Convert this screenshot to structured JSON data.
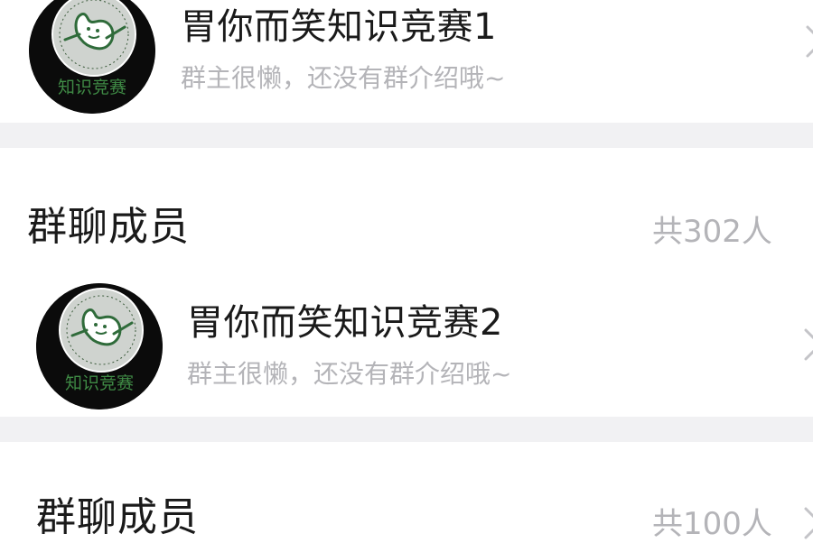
{
  "groups": [
    {
      "name": "胃你而笑知识竞赛1",
      "description": "群主很懒，还没有群介绍哦~",
      "avatar_text": "知识竞赛",
      "members_label": "群聊成员",
      "members_count": "共302人"
    },
    {
      "name": "胃你而笑知识竞赛2",
      "description": "群主很懒，还没有群介绍哦~",
      "avatar_text": "知识竞赛",
      "members_label": "群聊成员",
      "members_count": "共100人"
    }
  ],
  "colors": {
    "background": "#ffffff",
    "divider": "#f1f1f3",
    "primary_text": "#1a1a1a",
    "secondary_text": "#b4b4b8",
    "avatar_bg": "#0b0b0b",
    "avatar_emblem": "#cfd3cf",
    "avatar_stomach": "#2f6b3a",
    "avatar_label": "#3f8a45"
  },
  "icons": {
    "avatar": "stomach-emblem-logo",
    "chevron": "chevron-right-icon"
  }
}
